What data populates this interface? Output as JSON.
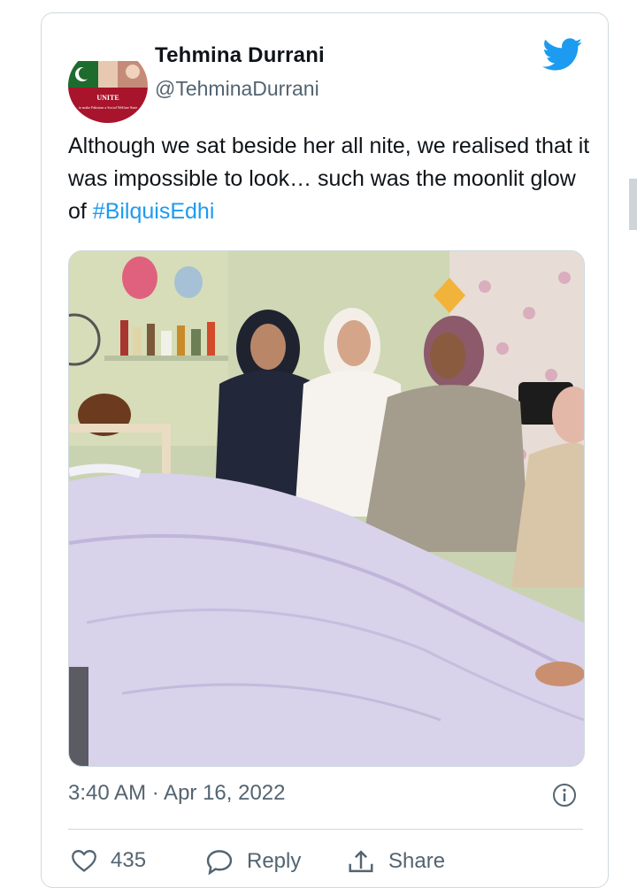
{
  "tweet": {
    "author": {
      "name": "Tehmina Durrani",
      "handle": "@TehminaDurrani",
      "avatar_banner_text": "UNITE",
      "avatar_caption": "to make Pakistan a Social Welfare State"
    },
    "platform_icon": "twitter-bird-icon",
    "text_main": "Although we sat beside her all nite, we realised that it was impossible to look… such was the moonlit glow of ",
    "hashtag": "#BilquisEdhi",
    "timestamp": "3:40 AM · Apr 16, 2022",
    "actions": {
      "like_count": "435",
      "reply_label": "Reply",
      "share_label": "Share"
    }
  },
  "colors": {
    "link": "#1d9bf0",
    "secondary_text": "#536471",
    "border": "#cfd9de",
    "twitter_blue": "#1d9bf0"
  },
  "icons": [
    "twitter-bird-icon",
    "info-icon",
    "heart-icon",
    "reply-icon",
    "share-icon"
  ]
}
